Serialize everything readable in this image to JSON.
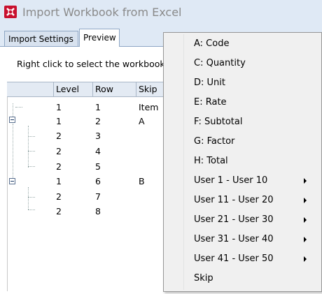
{
  "window": {
    "title": "Import Workbook from Excel",
    "tabs": [
      "Import Settings",
      "Preview"
    ]
  },
  "preview": {
    "hint": "Right click to select the workbook c",
    "columns": [
      "Level",
      "Row",
      "Skip"
    ],
    "rows": [
      {
        "level": "1",
        "row": "1",
        "skip": "Item"
      },
      {
        "level": "1",
        "row": "2",
        "skip": "A"
      },
      {
        "level": "2",
        "row": "3",
        "skip": ""
      },
      {
        "level": "2",
        "row": "4",
        "skip": ""
      },
      {
        "level": "2",
        "row": "5",
        "skip": ""
      },
      {
        "level": "1",
        "row": "6",
        "skip": "B"
      },
      {
        "level": "2",
        "row": "7",
        "skip": ""
      },
      {
        "level": "2",
        "row": "8",
        "skip": ""
      }
    ]
  },
  "context_menu": {
    "items": [
      {
        "label": "A: Code",
        "submenu": false
      },
      {
        "label": "C: Quantity",
        "submenu": false
      },
      {
        "label": "D: Unit",
        "submenu": false
      },
      {
        "label": "E: Rate",
        "submenu": false
      },
      {
        "label": "F: Subtotal",
        "submenu": false
      },
      {
        "label": "G: Factor",
        "submenu": false
      },
      {
        "label": "H: Total",
        "submenu": false
      },
      {
        "label": "User 1 - User 10",
        "submenu": true
      },
      {
        "label": "User 11 - User 20",
        "submenu": true
      },
      {
        "label": "User 21 - User 30",
        "submenu": true
      },
      {
        "label": "User 31 - User 40",
        "submenu": true
      },
      {
        "label": "User 41 - User 50",
        "submenu": true
      },
      {
        "label": "Skip",
        "submenu": false
      }
    ]
  },
  "colors": {
    "titlebar": "#dfe9f5",
    "menu_bg": "#f0f0f0",
    "app_icon": "#c8102e"
  }
}
